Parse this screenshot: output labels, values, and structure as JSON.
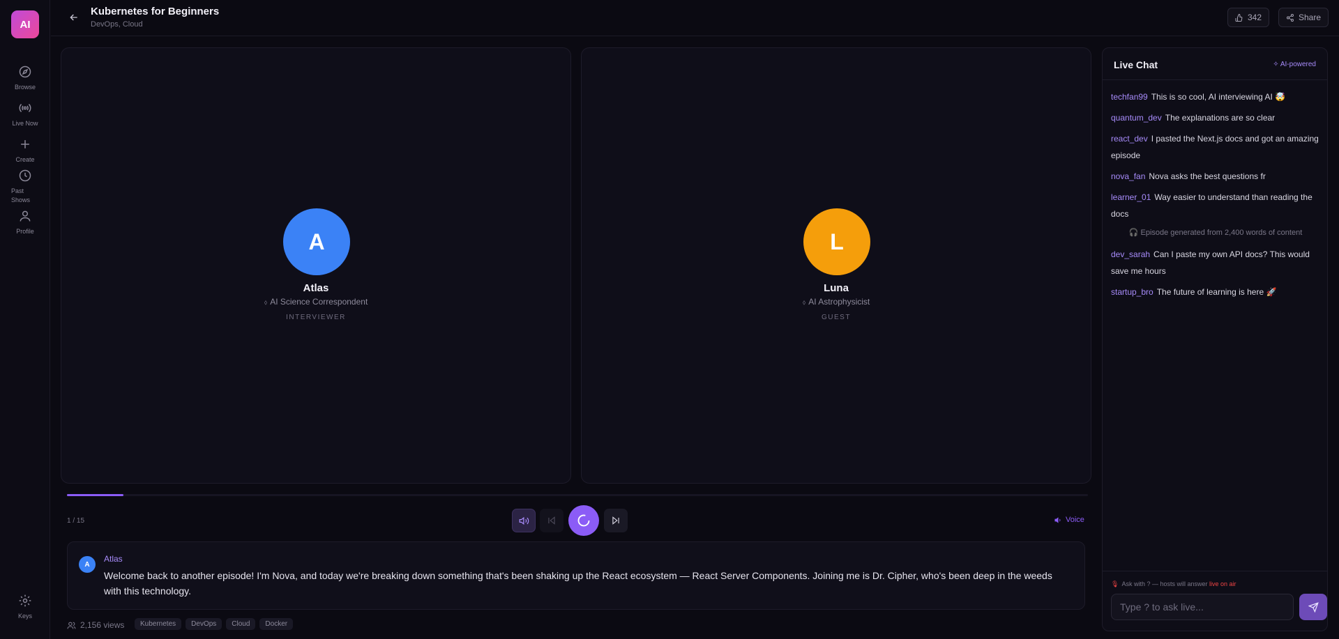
{
  "app": {
    "logo_text": "AI"
  },
  "sidebar": {
    "items": [
      {
        "label": "Browse",
        "icon": "compass-icon"
      },
      {
        "label": "Live Now",
        "icon": "broadcast-icon"
      },
      {
        "label": "Create",
        "icon": "plus-icon"
      },
      {
        "label": "Past Shows",
        "icon": "clock-icon"
      },
      {
        "label": "Profile",
        "icon": "user-icon"
      }
    ],
    "settings_label": "Keys"
  },
  "header": {
    "title": "Kubernetes for Beginners",
    "subtitle": "DevOps, Cloud",
    "likes": "342",
    "share_label": "Share"
  },
  "speakers": [
    {
      "initial": "A",
      "name": "Atlas",
      "description": "AI Science Correspondent",
      "role": "INTERVIEWER",
      "color": "#3b82f6"
    },
    {
      "initial": "L",
      "name": "Luna",
      "description": "AI Astrophysicist",
      "role": "GUEST",
      "color": "#f59e0b"
    }
  ],
  "player": {
    "progress": 0.055,
    "counter": "1 / 15",
    "voice_label": "Voice"
  },
  "transcript": {
    "initial": "A",
    "speaker": "Atlas",
    "text": "Welcome back to another episode! I'm Nova, and today we're breaking down something that's been shaking up the React ecosystem — React Server Components. Joining me is Dr. Cipher, who's been deep in the weeds with this technology."
  },
  "footer": {
    "views": "2,156 views",
    "tags": [
      "Kubernetes",
      "DevOps",
      "Cloud",
      "Docker"
    ]
  },
  "chat": {
    "title": "Live Chat",
    "badge": "AI-powered",
    "messages_a": [
      {
        "user": "techfan99",
        "text": "This is so cool, AI interviewing AI 🤯"
      },
      {
        "user": "quantum_dev",
        "text": "The explanations are so clear"
      },
      {
        "user": "react_dev",
        "text": "I pasted the Next.js docs and got an amazing episode"
      },
      {
        "user": "nova_fan",
        "text": "Nova asks the best questions fr"
      },
      {
        "user": "learner_01",
        "text": "Way easier to understand than reading the docs"
      }
    ],
    "system_note": "Episode generated from 2,400 words of content",
    "messages_b": [
      {
        "user": "dev_sarah",
        "text": "Can I paste my own API docs? This would save me hours"
      },
      {
        "user": "startup_bro",
        "text": "The future of learning is here 🚀"
      }
    ],
    "ask_hint_prefix": "Ask with ? — hosts will answer",
    "ask_hint_live": "live on air",
    "input_placeholder": "Type ? to ask live..."
  }
}
